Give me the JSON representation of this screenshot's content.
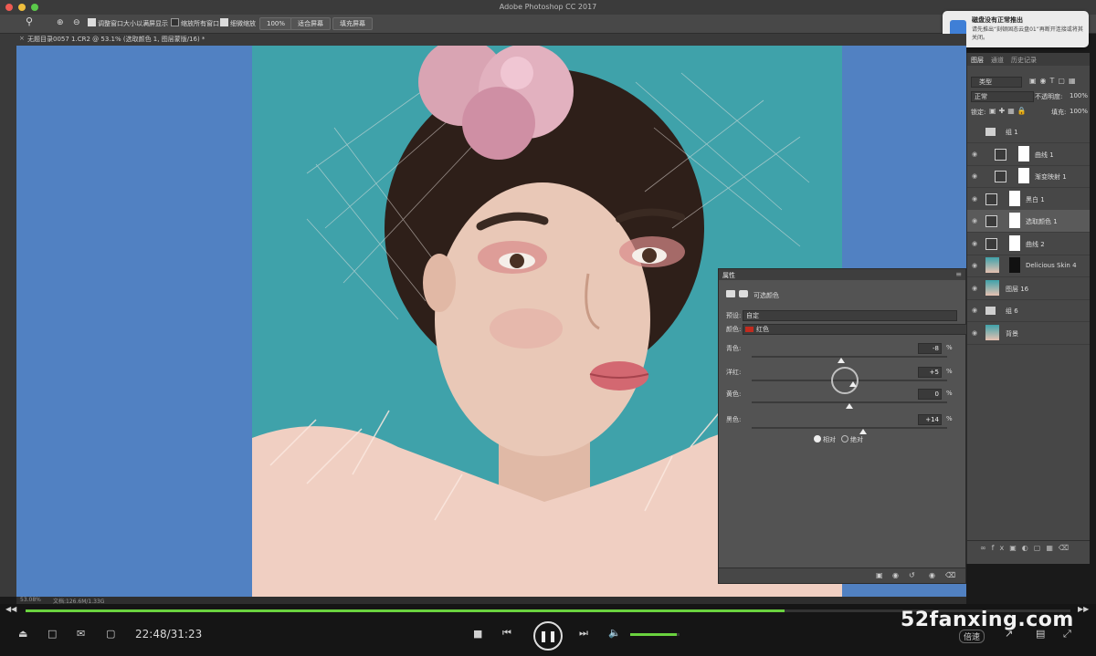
{
  "app_title": "Adobe Photoshop CC 2017",
  "options_bar": {
    "zoom_pct": "100%",
    "resize_windows": "调整窗口大小以满屏显示",
    "zoom_all": "缩放所有窗口",
    "scrubby_zoom": "细微缩放",
    "fit_screen": "适合屏幕",
    "fill_screen": "填充屏幕"
  },
  "document_tab": "无题目录0057 1.CR2 @ 53.1% (选取颜色 1, 图层蒙版/16) *",
  "notification": {
    "title": "磁盘没有正常推出",
    "body": "请先推出“刻顿固态云盘01”再断开连接或将其关闭。"
  },
  "layers_panel": {
    "tabs": [
      "图层",
      "通道",
      "历史记录"
    ],
    "filter_kind": "类型",
    "blend_mode": "正常",
    "opacity_label": "不透明度:",
    "opacity_value": "100%",
    "lock_label": "锁定:",
    "fill_label": "填充:",
    "fill_value": "100%",
    "layers": [
      {
        "name": "组 1"
      },
      {
        "name": "曲线 1"
      },
      {
        "name": "渐变映射 1"
      },
      {
        "name": "黑白 1"
      },
      {
        "name": "选取颜色 1"
      },
      {
        "name": "曲线 2"
      },
      {
        "name": "Delicious Skin 4"
      },
      {
        "name": "图层 16"
      },
      {
        "name": "组 6"
      },
      {
        "name": "背景"
      }
    ]
  },
  "properties_panel": {
    "tab": "属性",
    "title": "可选颜色",
    "preset_label": "预设:",
    "preset_value": "自定",
    "colors_label": "颜色:",
    "colors_value": "红色",
    "sliders": [
      {
        "label": "青色:",
        "value": "-8",
        "unit": "%",
        "pos": 0.46
      },
      {
        "label": "洋红:",
        "value": "+5",
        "unit": "%",
        "pos": 0.52
      },
      {
        "label": "黄色:",
        "value": "0",
        "unit": "%",
        "pos": 0.5
      },
      {
        "label": "黑色:",
        "value": "+14",
        "unit": "%",
        "pos": 0.57
      }
    ],
    "method_relative": "相对",
    "method_absolute": "绝对"
  },
  "status_bar": {
    "zoom": "53.08%",
    "doc": "文档:126.6M/1.33G"
  },
  "player": {
    "timecode": "22:48/31:23",
    "progress": 0.726,
    "volume": 0.95,
    "watermark": "52fanxing.com",
    "speed_label": "倍速"
  },
  "colors": {
    "canvas_bg": "#5181c2",
    "photo_bg": "#3fa2aa",
    "progress": "#6ad23f"
  }
}
